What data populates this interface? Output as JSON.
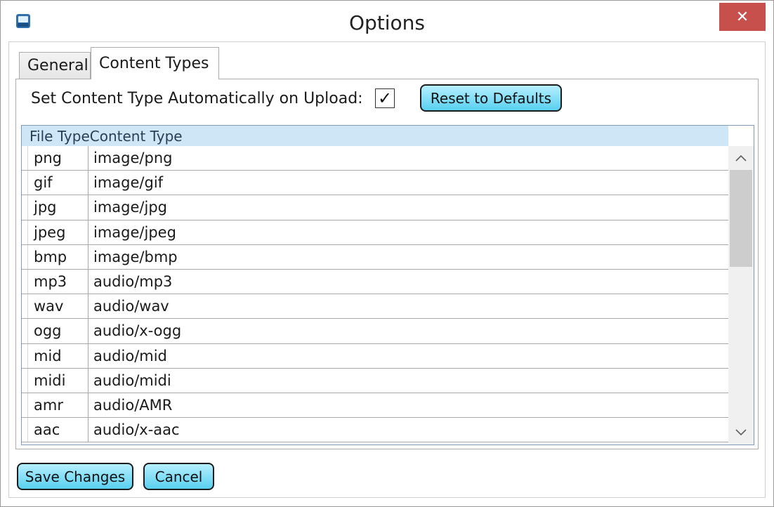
{
  "window": {
    "title": "Options",
    "close_glyph": "✕",
    "app_icon": "drive-icon"
  },
  "tabs": [
    {
      "label": "General",
      "selected": false
    },
    {
      "label": "Content Types",
      "selected": true
    }
  ],
  "content_types": {
    "auto_label": "Set Content Type Automatically on Upload:",
    "auto_checked": true,
    "check_glyph": "✓",
    "reset_label": "Reset to Defaults",
    "columns": [
      "File Type",
      "Content Type"
    ],
    "rows": [
      {
        "file": "png",
        "type": "image/png"
      },
      {
        "file": "gif",
        "type": "image/gif"
      },
      {
        "file": "jpg",
        "type": "image/jpg"
      },
      {
        "file": "jpeg",
        "type": "image/jpeg"
      },
      {
        "file": "bmp",
        "type": "image/bmp"
      },
      {
        "file": "mp3",
        "type": "audio/mp3"
      },
      {
        "file": "wav",
        "type": "audio/wav"
      },
      {
        "file": "ogg",
        "type": "audio/x-ogg"
      },
      {
        "file": "mid",
        "type": "audio/mid"
      },
      {
        "file": "midi",
        "type": "audio/midi"
      },
      {
        "file": "amr",
        "type": "audio/AMR"
      },
      {
        "file": "aac",
        "type": "audio/x-aac"
      }
    ]
  },
  "footer": {
    "save_label": "Save Changes",
    "cancel_label": "Cancel"
  },
  "colors": {
    "button_top": "#b6efff",
    "button_bottom": "#58d0f0",
    "close_bg": "#c7504c",
    "header_bg": "#cfe6f6"
  }
}
